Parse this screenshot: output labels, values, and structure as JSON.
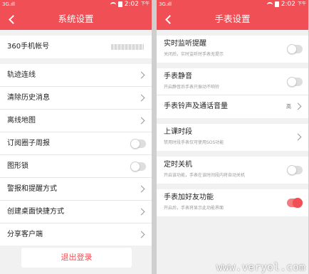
{
  "statusbar": {
    "carrier": "3G.ıll",
    "time": "2:02",
    "ampm": "下午",
    "color": "#f04f55"
  },
  "left": {
    "title": "系统设置",
    "account": {
      "label": "360手机帐号"
    },
    "items": [
      {
        "label": "轨迹连线"
      },
      {
        "label": "清除历史消息"
      },
      {
        "label": "离线地图"
      },
      {
        "label": "订阅圈子周报"
      },
      {
        "label": "图形锁"
      },
      {
        "label": "警报和提醒方式"
      },
      {
        "label": "创建桌面快捷方式"
      },
      {
        "label": "分享客户端"
      }
    ],
    "logout": "退出登录"
  },
  "right": {
    "title": "手表设置",
    "items": [
      {
        "label": "实时监听提醒",
        "sub": "关闭后，实时监听时手表无提示",
        "toggle": false
      },
      {
        "label": "手表静音",
        "sub": "开启静音后手表只振动不响铃",
        "toggle": false
      },
      {
        "label": "手表铃声及通话音量",
        "value": "高"
      },
      {
        "label": "上课时段",
        "sub": "禁用时段手表仅可使用SOS功能"
      },
      {
        "label": "定时关机",
        "sub": "开启该功能，手表在该时间段内将自动关机",
        "toggle": false
      },
      {
        "label": "手表加好友功能",
        "sub": "开启后，手表将显示此功能界面",
        "toggle": true
      }
    ]
  },
  "watermark": "www.veryol.com"
}
